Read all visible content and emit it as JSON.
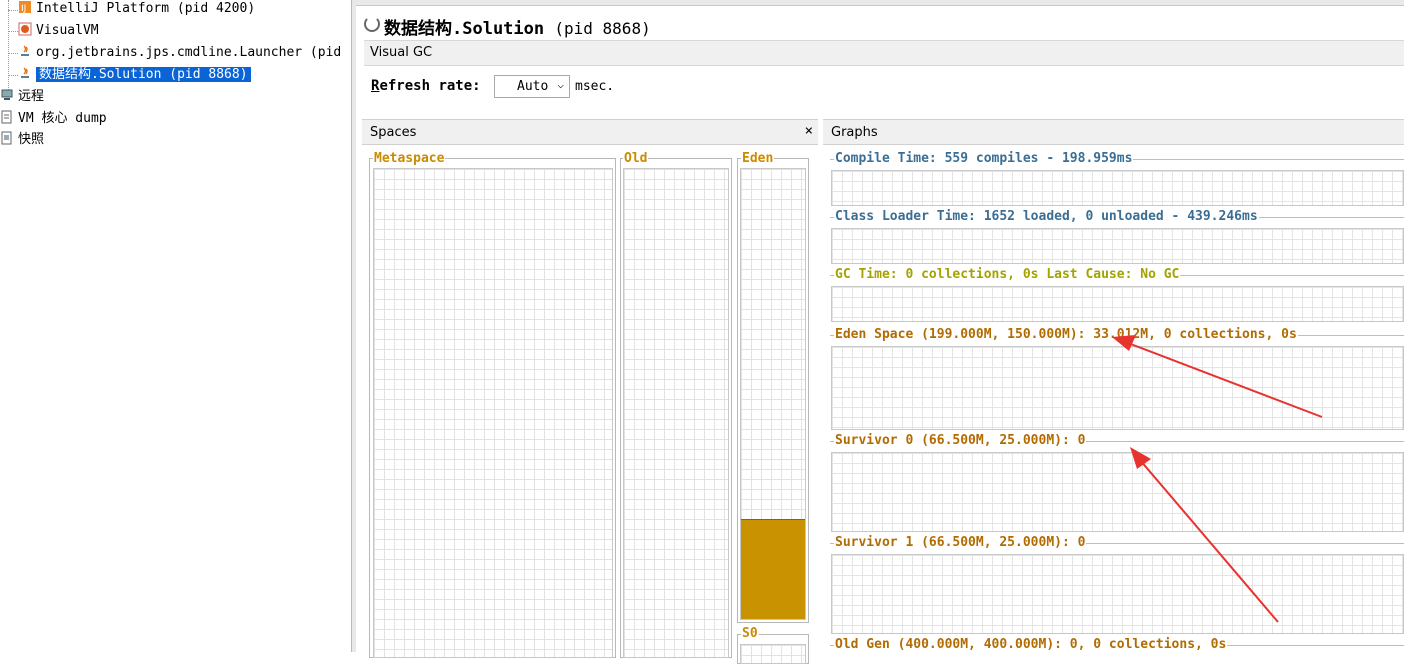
{
  "tree": {
    "items": [
      {
        "label": "IntelliJ Platform (pid 4200)",
        "icon": "intellij-icon"
      },
      {
        "label": "VisualVM",
        "icon": "visualvm-icon"
      },
      {
        "label": "org.jetbrains.jps.cmdline.Launcher (pid",
        "icon": "java-icon"
      },
      {
        "label": "数据结构.Solution (pid 8868)",
        "icon": "java-icon",
        "selected": true
      }
    ],
    "groups": [
      {
        "label": "远程",
        "icon": "remote-host-icon"
      },
      {
        "label": "VM 核心 dump",
        "icon": "core-dump-icon"
      },
      {
        "label": "快照",
        "icon": "snapshot-icon"
      }
    ]
  },
  "app": {
    "title": "数据结构.Solution",
    "pid": "(pid 8868)"
  },
  "tab": {
    "label": "Visual GC"
  },
  "refresh": {
    "label_prefix": "R",
    "label_rest": "efresh rate:",
    "value": "Auto",
    "unit": "msec."
  },
  "spaces": {
    "title": "Spaces",
    "close": "×",
    "metaspace": "Metaspace",
    "old": "Old",
    "eden": "Eden",
    "s0": "S0",
    "eden_fill_fraction": 0.22
  },
  "graphs": {
    "title": "Graphs",
    "compile": "Compile Time: 559 compiles - 198.959ms",
    "classloader": "Class Loader Time: 1652 loaded, 0 unloaded - 439.246ms",
    "gc": "GC Time: 0 collections, 0s Last Cause: No GC",
    "eden": "Eden Space (199.000M, 150.000M): 33.012M, 0 collections, 0s",
    "survivor0": "Survivor 0 (66.500M, 25.000M): 0",
    "survivor1": "Survivor 1 (66.500M, 25.000M): 0",
    "oldgen": "Old Gen (400.000M, 400.000M): 0, 0 collections, 0s"
  },
  "colors": {
    "selection": "#0a64d6",
    "eden_fill": "#c89200",
    "annotation_arrow": "#e8322d"
  }
}
